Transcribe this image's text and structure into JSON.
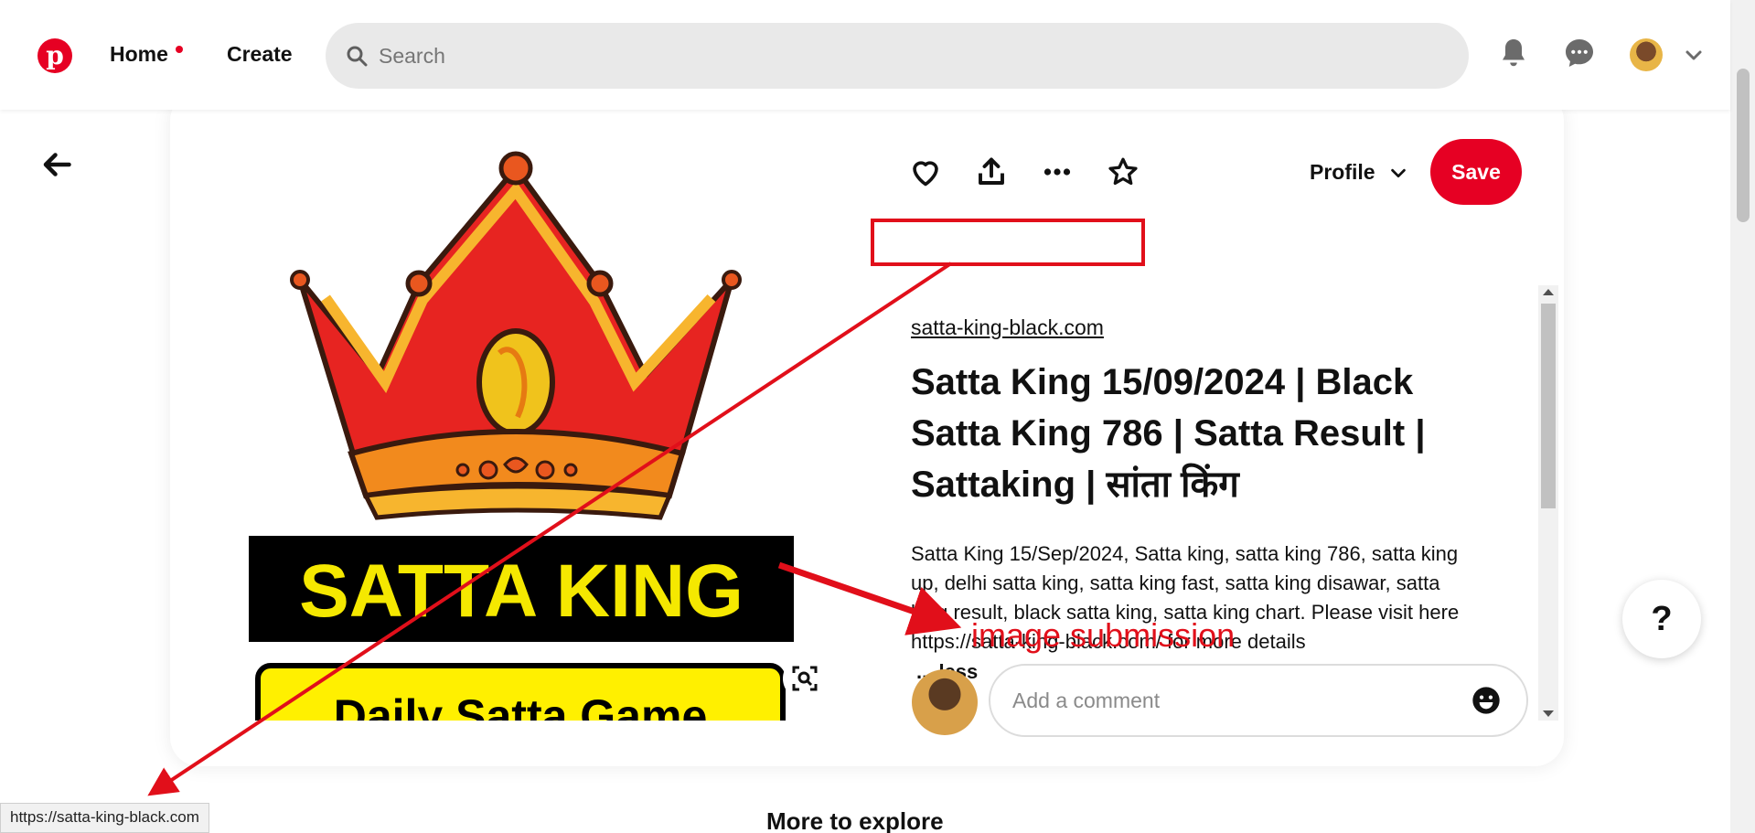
{
  "header": {
    "logo": "pinterest-logo",
    "nav": {
      "home": "Home",
      "create": "Create"
    },
    "search": {
      "placeholder": "Search",
      "value": ""
    },
    "icons": [
      "bell-icon",
      "chat-icon",
      "avatar",
      "chevron-down-icon"
    ]
  },
  "pin": {
    "image": {
      "crown": "crown-logo",
      "banner_text": "SATTA KING",
      "sub_banner_text": "Daily Satta Game"
    },
    "actions": {
      "icons": [
        "heart-icon",
        "share-icon",
        "more-icon",
        "star-icon"
      ],
      "profile_label": "Profile",
      "save_label": "Save"
    },
    "source_link": "satta-king-black.com",
    "title": "Satta King 15/09/2024 | Black Satta King 786 | Satta Result | Sattaking | सांता किंग",
    "description": "Satta King 15/Sep/2024, Satta king, satta king 786, satta king up, delhi satta king, satta king fast, satta king disawar, satta king result, black satta king, satta king chart. Please visit here https://satta-king-black.com/ for more details",
    "less_label": "... less",
    "comment": {
      "placeholder": "Add a comment",
      "value": ""
    }
  },
  "help_label": "?",
  "more_to_explore": "More to explore",
  "status_url": "https://satta-king-black.com",
  "annotation": {
    "label": "image submission",
    "color": "#e10f1a"
  },
  "colors": {
    "brand": "#e60023",
    "banner_bg": "#000000",
    "banner_text": "#f5e800",
    "sub_banner_bg": "#fff000"
  }
}
